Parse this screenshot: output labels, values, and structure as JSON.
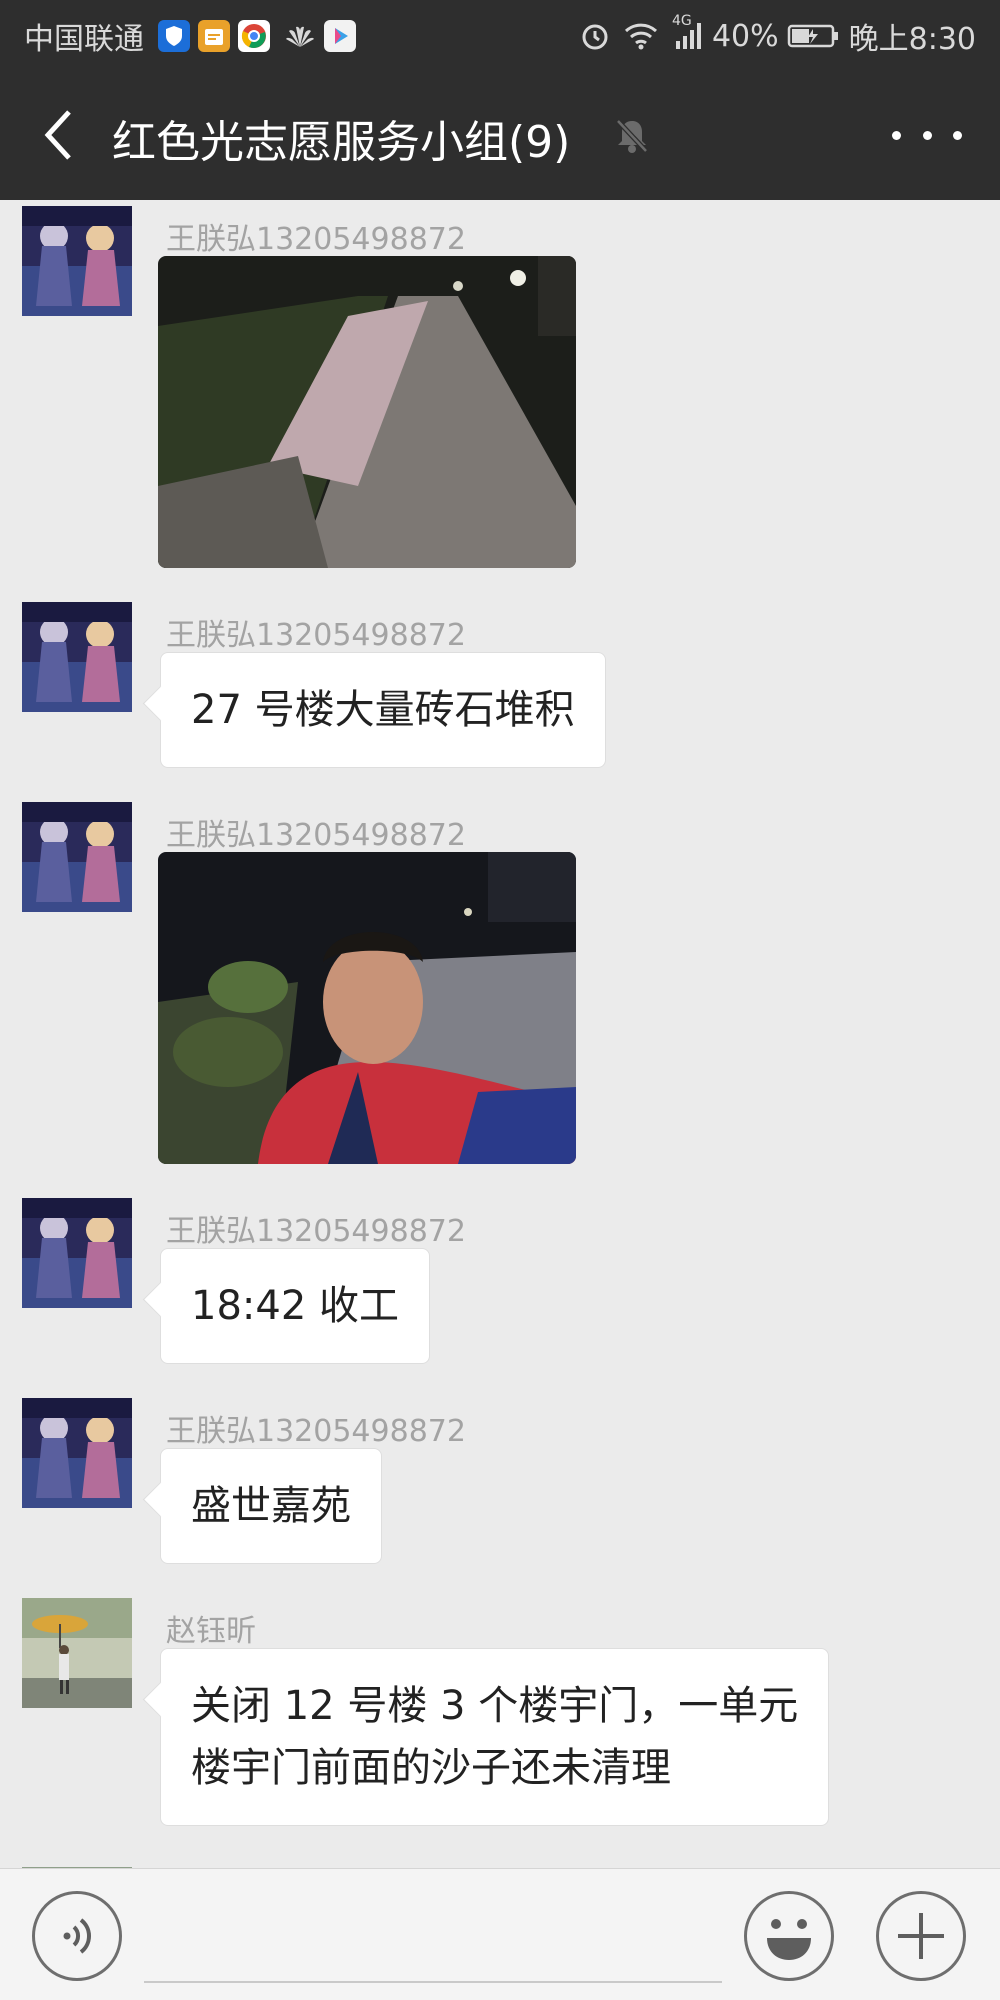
{
  "status_bar": {
    "carrier": "中国联通",
    "network": "4G",
    "battery": "40%",
    "time": "晚上8:30",
    "icons": [
      "shield-app-icon",
      "calendar-app-icon",
      "chrome-app-icon",
      "huawei-logo-icon",
      "video-app-icon",
      "alarm-icon",
      "wifi-icon",
      "signal-icon",
      "battery-icon"
    ]
  },
  "header": {
    "title": "红色光志愿服务小组(9)",
    "icons": [
      "back-arrow-icon",
      "mute-bell-icon",
      "more-dots-icon"
    ]
  },
  "messages": [
    {
      "sender": "王朕弘13205498872",
      "type": "image",
      "image": "street-bricks-night-photo"
    },
    {
      "sender": "王朕弘13205498872",
      "type": "text",
      "text": "27 号楼大量砖石堆积"
    },
    {
      "sender": "王朕弘13205498872",
      "type": "image",
      "image": "volunteer-selfie-night-photo"
    },
    {
      "sender": "王朕弘13205498872",
      "type": "text",
      "text": "18:42 收工"
    },
    {
      "sender": "王朕弘13205498872",
      "type": "text",
      "text": "盛世嘉苑"
    },
    {
      "sender": "赵钰昕",
      "type": "text",
      "lines": [
        "关闭 12 号楼 3 个楼宇门，一单元",
        "楼宇门前面的沙子还未清理"
      ]
    }
  ],
  "input_bar": {
    "placeholder": "",
    "icons": [
      "voice-icon",
      "emoji-icon",
      "plus-icon"
    ]
  },
  "colors": {
    "header_bg": "#2e2e2e",
    "chat_bg": "#ebebeb",
    "bubble_bg": "#ffffff",
    "sender_text": "#a3a3a3"
  }
}
